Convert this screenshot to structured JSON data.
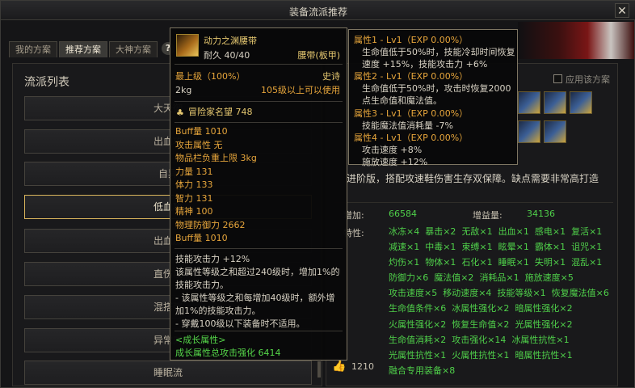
{
  "window": {
    "title": "装备流派推荐",
    "close_label": "✕"
  },
  "tabs": [
    {
      "label": "我的方案",
      "active": false
    },
    {
      "label": "推荐方案",
      "active": true
    },
    {
      "label": "大神方案",
      "active": false
    }
  ],
  "help_label": "?",
  "left_panel": {
    "title": "流派列表",
    "items": [
      {
        "label": "大天御",
        "selected": false
      },
      {
        "label": "出血攻",
        "selected": false
      },
      {
        "label": "自异",
        "selected": false
      },
      {
        "label": "低血攻",
        "selected": true
      },
      {
        "label": "出血加",
        "selected": false
      },
      {
        "label": "直伤攻",
        "selected": false
      },
      {
        "label": "混搭强",
        "selected": false
      },
      {
        "label": "异常对",
        "selected": false
      },
      {
        "label": "睡眠流",
        "selected": false
      }
    ]
  },
  "right_panel": {
    "apply_label": "应用该方案",
    "description_lines": [
      "进阶版，搭配攻速鞋伤害生存双保障。缺点需要非常高打造"
    ],
    "stat1_label": "增加:",
    "stat1_value": "66584",
    "stat2_label": "增益量:",
    "stat2_value": "34136",
    "features_label": "特性:",
    "features": [
      "冰冻×4",
      "暴击×2",
      "无敌×1",
      "出血×1",
      "感电×1",
      "复活×1",
      "减速×1",
      "中毒×1",
      "束缚×1",
      "眩晕×1",
      "霸体×1",
      "诅咒×1",
      "灼伤×1",
      "物体×1",
      "石化×1",
      "睡眠×1",
      "失明×1",
      "混乱×1",
      "防御力×6",
      "魔法值×2",
      "消耗品×1",
      "施放速度×5",
      "攻击速度×5",
      "移动速度×4",
      "技能等级×1",
      "恢复魔法值×6",
      "生命值条件×6",
      "冰属性强化×2",
      "暗属性强化×2",
      "火属性强化×2",
      "恢复生命值×2",
      "光属性强化×2",
      "生命值消耗×2",
      "攻击强化×14",
      "冰属性抗性×1",
      "光属性抗性×1",
      "火属性抗性×1",
      "暗属性抗性×1",
      "融合专用装备×8"
    ],
    "like_icon": "thumbs-up-icon",
    "like_count": "1210"
  },
  "tooltip_item": {
    "name": "动力之渊腰带",
    "durability": "耐久 40/40",
    "type": "腰带(板甲)",
    "level": "最上级（100%）",
    "grade": "史诗",
    "weight": "2kg",
    "requirement": "105级以上可以使用",
    "fame": "冒险家名望 748",
    "stats": [
      "Buff量 1010",
      "攻击属性 无",
      "物品栏负重上限 3kg",
      "力量 131",
      "体力 133",
      "智力 131",
      "精神 100",
      "物理防御力 2662",
      "Buff量 1010"
    ],
    "skill_lines": [
      "技能攻击力 +12%",
      "该属性等级之和超过240级时，增加1%的",
      "技能攻击力。",
      "- 该属性等级之和每增加40级时，额外增",
      "加1%的技能攻击力。",
      "- 穿戴100级以下装备时不适用。"
    ],
    "growth_title": "<成长属性>",
    "growth_line": "成长属性总攻击强化 6414"
  },
  "tooltip_attrs": {
    "entries": [
      {
        "header": "属性1 - Lv1（EXP 0.00%）",
        "lines": [
          "生命值低于50%时，技能冷却时间恢复",
          "速度 +15%，技能攻击力 +6%"
        ]
      },
      {
        "header": "属性2 - Lv1（EXP 0.00%）",
        "lines": [
          "生命值低于50%时，攻击时恢复2000",
          "点生命值和魔法值。"
        ]
      },
      {
        "header": "属性3 - Lv1（EXP 0.00%）",
        "lines": [
          "技能魔法值消耗量 -7%"
        ]
      },
      {
        "header": "属性4 - Lv1（EXP 0.00%）",
        "lines": [
          "攻击速度 +8%",
          "施放速度 +12%"
        ]
      }
    ]
  }
}
